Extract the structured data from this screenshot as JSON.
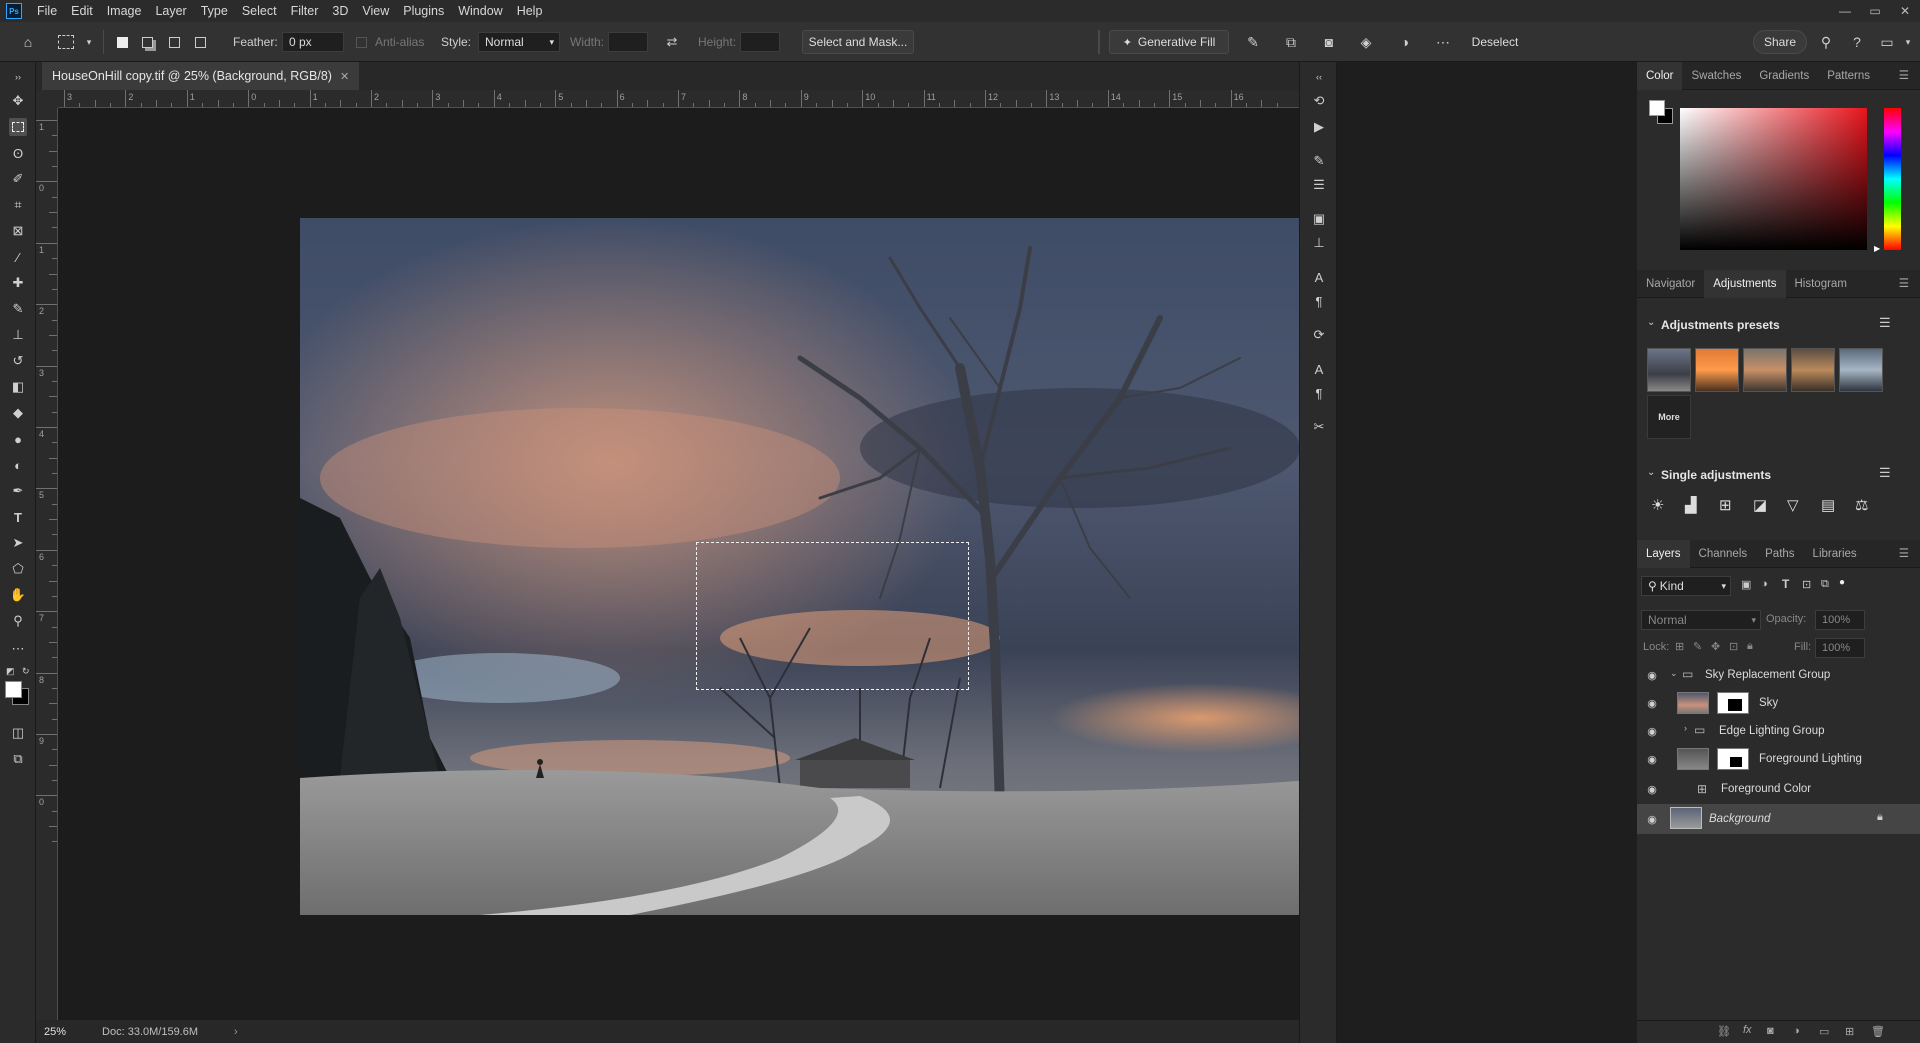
{
  "menu": [
    "File",
    "Edit",
    "Image",
    "Layer",
    "Type",
    "Select",
    "Filter",
    "3D",
    "View",
    "Plugins",
    "Window",
    "Help"
  ],
  "app_logo": "Ps",
  "window_controls": [
    "—",
    "▭",
    "✕"
  ],
  "options": {
    "feather_label": "Feather:",
    "feather_value": "0 px",
    "antialias_label": "Anti-alias",
    "style_label": "Style:",
    "style_value": "Normal",
    "width_label": "Width:",
    "height_label": "Height:",
    "select_mask_label": "Select and Mask...",
    "generative_fill_label": "Generative Fill",
    "deselect_label": "Deselect",
    "share_label": "Share"
  },
  "document": {
    "tab_title": "HouseOnHill copy.tif @ 25% (Background, RGB/8)",
    "zoom": "25%",
    "doc_info": "Doc: 33.0M/159.6M"
  },
  "rulers": {
    "h_labels": [
      "3",
      "2",
      "1",
      "0",
      "1",
      "2",
      "3",
      "4",
      "5",
      "6",
      "7",
      "8",
      "9",
      "10",
      "11",
      "12",
      "13",
      "14",
      "15",
      "16"
    ],
    "v_labels": [
      "1",
      "0",
      "1",
      "2",
      "3",
      "4",
      "5",
      "6",
      "7",
      "8",
      "9",
      "0"
    ]
  },
  "color_panel": {
    "tabs": [
      "Color",
      "Swatches",
      "Gradients",
      "Patterns"
    ],
    "active": "Color",
    "fg_color": "#ffffff",
    "bg_color": "#000000",
    "hue_color": "#e8141c"
  },
  "adjust_panel": {
    "tabs": [
      "Navigator",
      "Adjustments",
      "Histogram"
    ],
    "active": "Adjustments",
    "presets_heading": "Adjustments presets",
    "more_label": "More",
    "single_heading": "Single adjustments"
  },
  "layers_panel": {
    "tabs": [
      "Layers",
      "Channels",
      "Paths",
      "Libraries"
    ],
    "active": "Layers",
    "kind_label": "Kind",
    "blend_mode": "Normal",
    "opacity_label": "Opacity:",
    "opacity_value": "100%",
    "lock_label": "Lock:",
    "fill_label": "Fill:",
    "fill_value": "100%",
    "layers": [
      {
        "name": "Sky Replacement Group"
      },
      {
        "name": "Sky"
      },
      {
        "name": "Edge Lighting Group"
      },
      {
        "name": "Foreground Lighting"
      },
      {
        "name": "Foreground Color"
      },
      {
        "name": "Background"
      }
    ]
  }
}
